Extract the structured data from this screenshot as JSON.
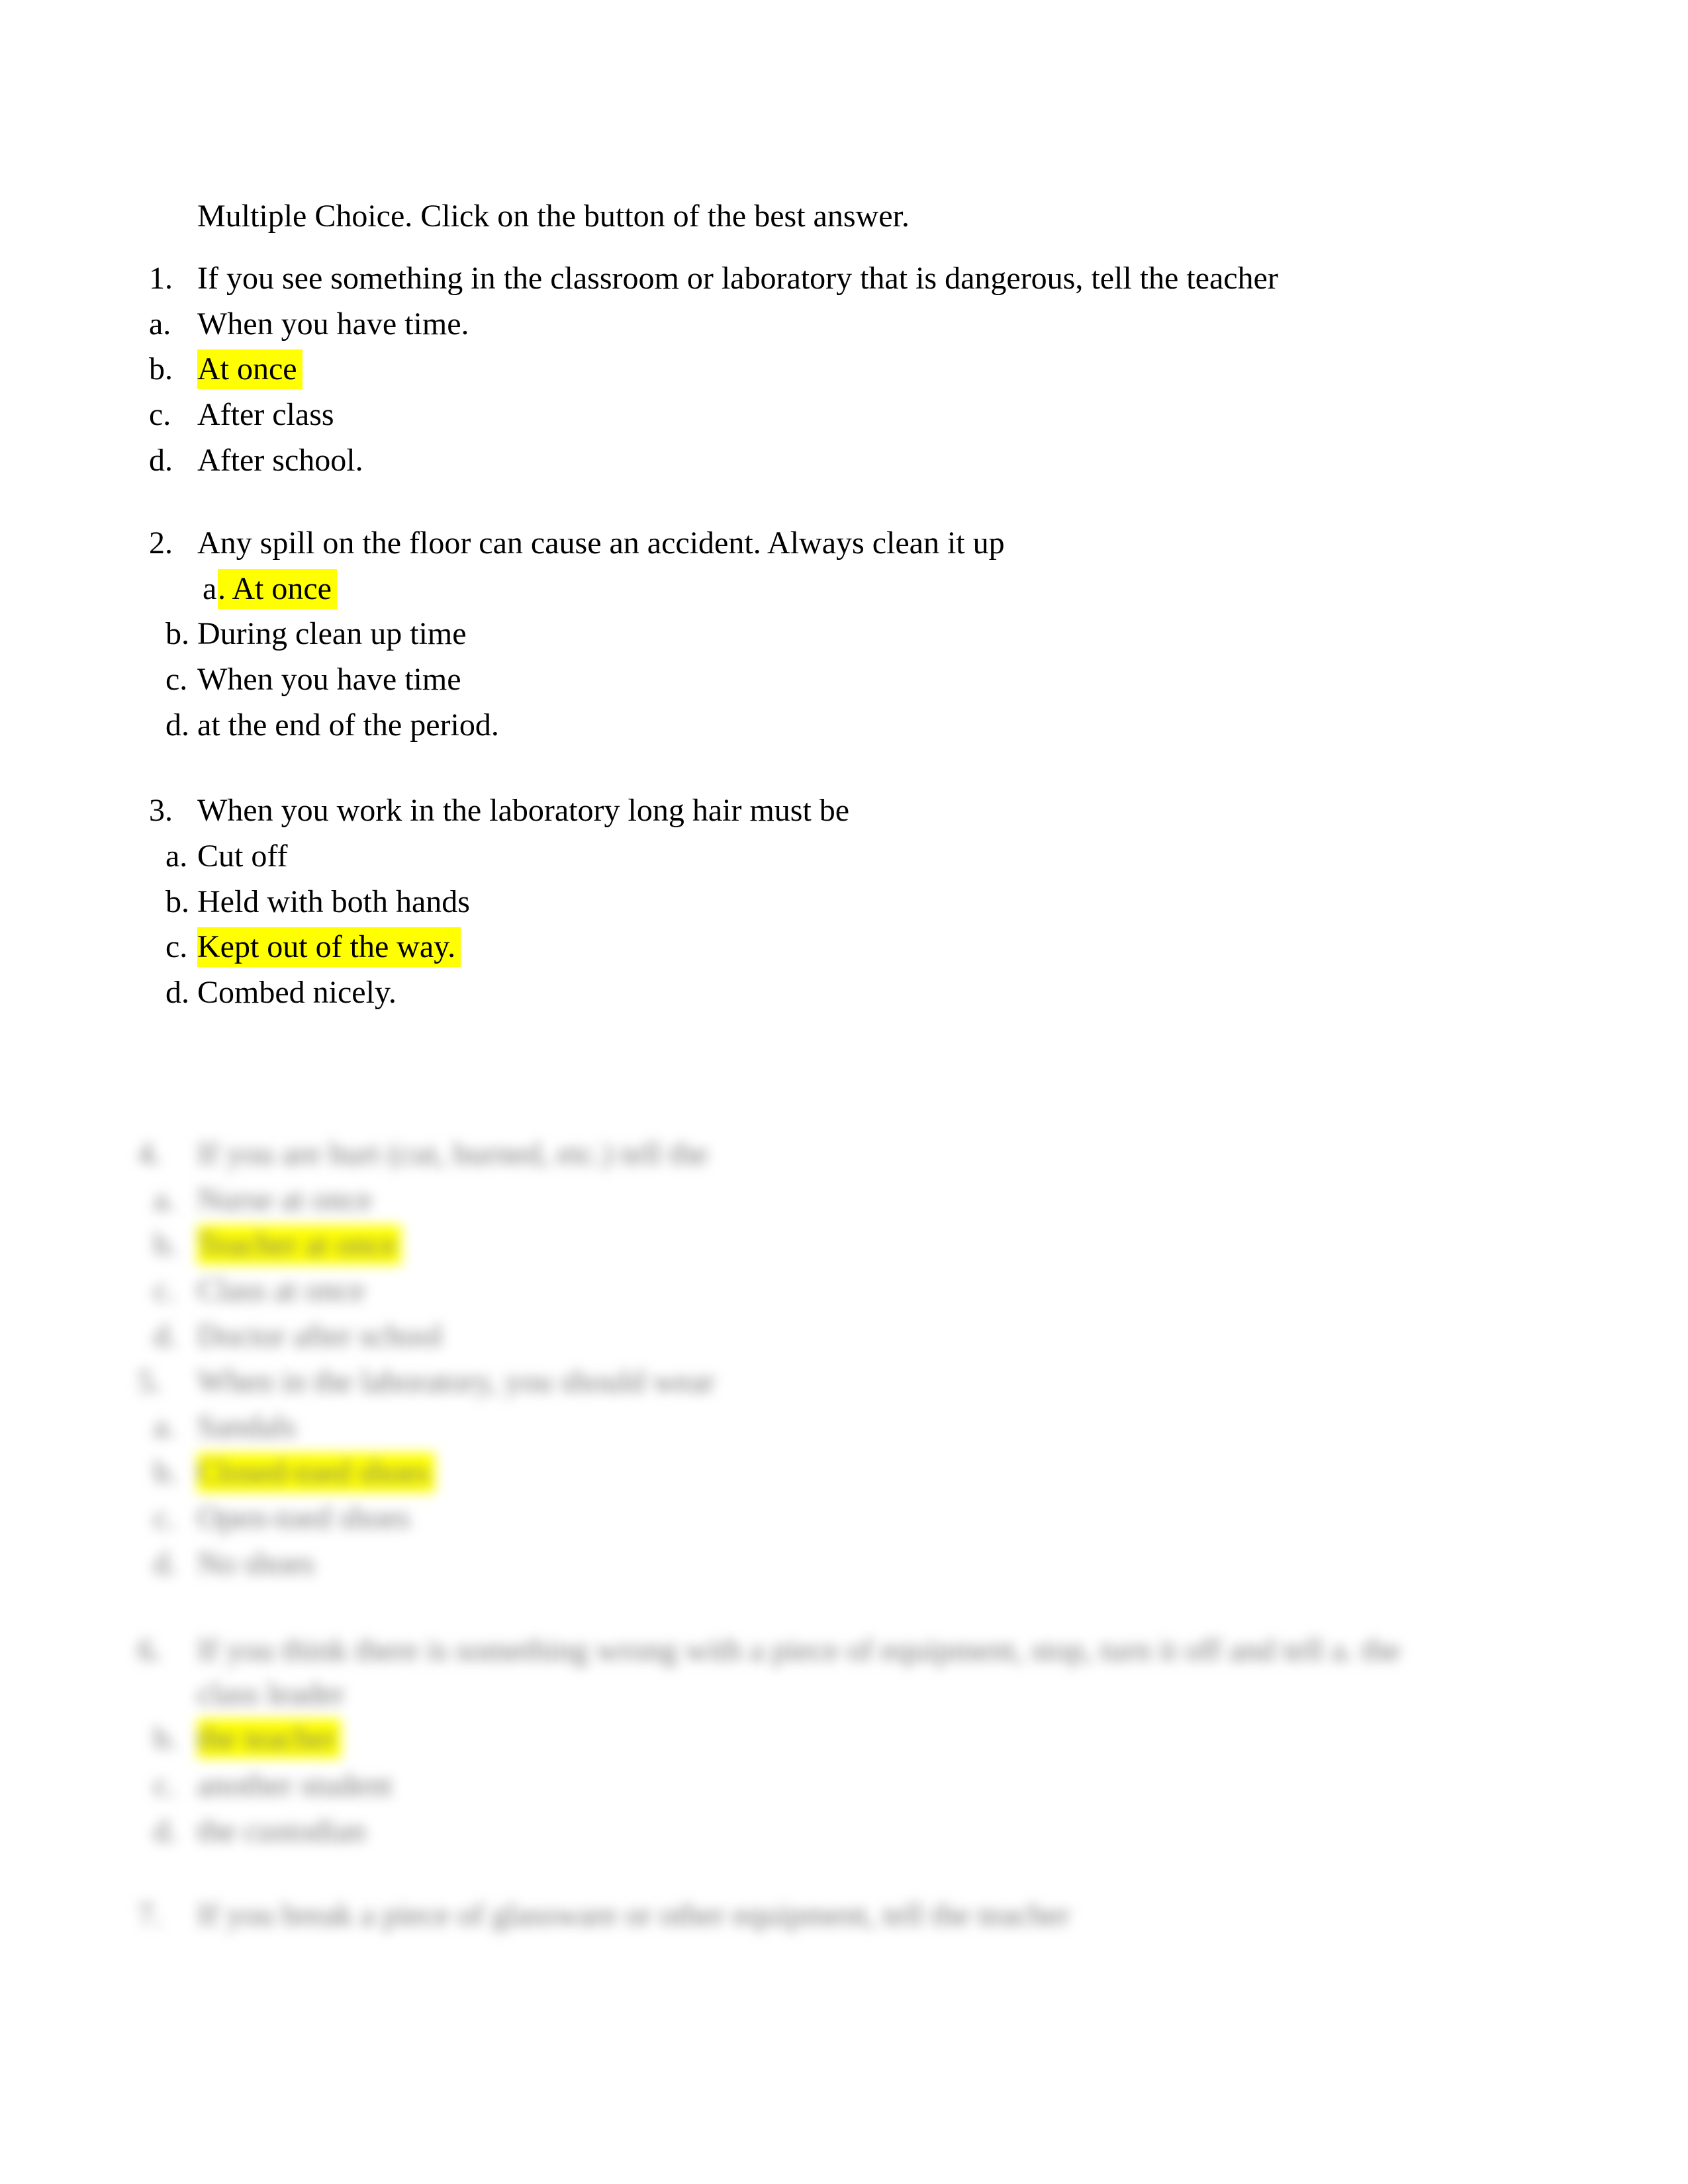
{
  "instructions": "Multiple Choice. Click on the button of the best answer.",
  "questions": [
    {
      "number": "1.",
      "text": "If you see something in the classroom or laboratory that is dangerous, tell the teacher",
      "options": [
        {
          "label": "a.",
          "text": "When you have time.",
          "highlighted": false
        },
        {
          "label": "b.",
          "text": "At once",
          "highlighted": true
        },
        {
          "label": "c.",
          "text": "After class",
          "highlighted": false
        },
        {
          "label": "d.",
          "text": "After school.",
          "highlighted": false
        }
      ]
    },
    {
      "number": "2.",
      "text": "Any spill on the floor can cause an accident. Always clean it up",
      "options": [
        {
          "label": "a",
          "text": ". At once",
          "highlighted": true
        },
        {
          "label": "b.",
          "text": "During clean up time",
          "highlighted": false
        },
        {
          "label": "c.",
          "text": "When you have time",
          "highlighted": false
        },
        {
          "label": "d.",
          "text": "at the end of the period.",
          "highlighted": false
        }
      ]
    },
    {
      "number": "3.",
      "text": "When you work in the laboratory long hair must be",
      "options": [
        {
          "label": "a.",
          "text": "Cut off",
          "highlighted": false
        },
        {
          "label": "b.",
          "text": "Held with both hands",
          "highlighted": false
        },
        {
          "label": "c.",
          "text": "Kept out of the way.",
          "highlighted": true
        },
        {
          "label": "d.",
          "text": "Combed nicely.",
          "highlighted": false
        }
      ]
    },
    {
      "number": "4.",
      "text": "If you are hurt (cut, burned, etc.) tell the",
      "blurred": true,
      "options": [
        {
          "label": "a.",
          "text": "Nurse at once",
          "highlighted": false
        },
        {
          "label": "b.",
          "text": "Teacher at once",
          "highlighted": true
        },
        {
          "label": "c.",
          "text": "Class at once",
          "highlighted": false
        },
        {
          "label": "d.",
          "text": "Doctor after school",
          "highlighted": false
        }
      ]
    },
    {
      "number": "5.",
      "text": "When in the laboratory, you should wear",
      "blurred": true,
      "options": [
        {
          "label": "a.",
          "text": "Sandals",
          "highlighted": false
        },
        {
          "label": "b.",
          "text": "Closed-toed shoes",
          "highlighted": true
        },
        {
          "label": "c.",
          "text": "Open-toed shoes",
          "highlighted": false
        },
        {
          "label": "d.",
          "text": "No shoes",
          "highlighted": false
        }
      ]
    },
    {
      "number": "6.",
      "text": "If you think there is something wrong with a piece of equipment, stop, turn it off and tell a. the",
      "text_continued": "class leader",
      "blurred": true,
      "options": [
        {
          "label": "b.",
          "text": "the teacher",
          "highlighted": true
        },
        {
          "label": "c.",
          "text": "another student",
          "highlighted": false
        },
        {
          "label": "d.",
          "text": "the custodian",
          "highlighted": false
        }
      ]
    },
    {
      "number": "7.",
      "text": "If you break a piece of glassware or other equipment, tell the teacher",
      "blurred": true,
      "options": []
    }
  ],
  "colors": {
    "highlight": "#ffff00",
    "text": "#000000"
  }
}
